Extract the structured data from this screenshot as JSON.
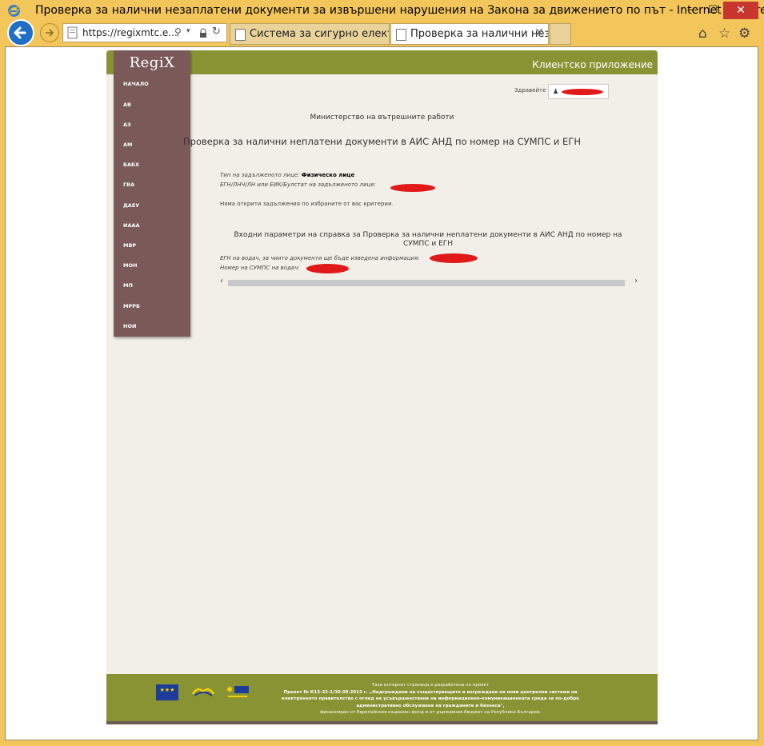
{
  "window": {
    "title": "Проверка за налични незаплатени документи за извършени нарушения на Закона за движението по път - Internet Explorer",
    "min_label": "—",
    "max_label": "☐",
    "close_label": "✕"
  },
  "browser": {
    "address": "https://regixmtc.e...",
    "tabs": [
      {
        "label": "Система за сигурно електрон..."
      },
      {
        "label": "Проверка за налични неза..."
      }
    ],
    "tab_close": "✕"
  },
  "app": {
    "header_title": "Клиентско приложение",
    "logo": "RegiX",
    "greeting": "Здравейте",
    "menu": [
      "НАЧАЛО",
      "АВ",
      "АЗ",
      "АМ",
      "БАБХ",
      "ГВА",
      "ДАЕУ",
      "ИААА",
      "МВР",
      "МОН",
      "МП",
      "МРРБ",
      "НОИ"
    ],
    "ministry": "Министерство на вътрешните работи",
    "page_title": "Проверка за налични неплатени документи в АИС АНД по номер на СУМПС и ЕГН",
    "person_type_label": "Тип на задълженото лице:",
    "person_type_value": "Физическо лице",
    "id_label": "ЕГН/ЛНЧ/ЛН или ЕИК/Булстат на задълженото лице:",
    "no_results": "Няма открити задължения по избраните от вас критерии.",
    "params_title": "Входни параметри на справка за Проверка за налични неплатени документи в АИС АНД по номер на СУМПС и ЕГН",
    "egn_label": "ЕГН на водач, за чиито документи ще бъде изведена информация:",
    "license_label": "Номер на СУМПС на водач:"
  },
  "footer": {
    "line1": "Тази интернет страница е разработена по проект",
    "line2": "Проект № К13-32-1/30.09.2013 г. „Надграждане на съществуващите и изграждане на нови централни системи на",
    "line3": "електронното правителство с оглед на усъвършенстване на информационно-комуникационната среда за по-добро",
    "line4": "административно обслужване на гражданите и бизнеса\",",
    "line5": "финансиран от Европейския социален фонд и от държавния бюджет на Република България."
  },
  "colors": {
    "accent": "#8a9334",
    "sidebar": "#7a5a58",
    "redaction": "#e01919",
    "ie_frame": "#f3c65c"
  }
}
